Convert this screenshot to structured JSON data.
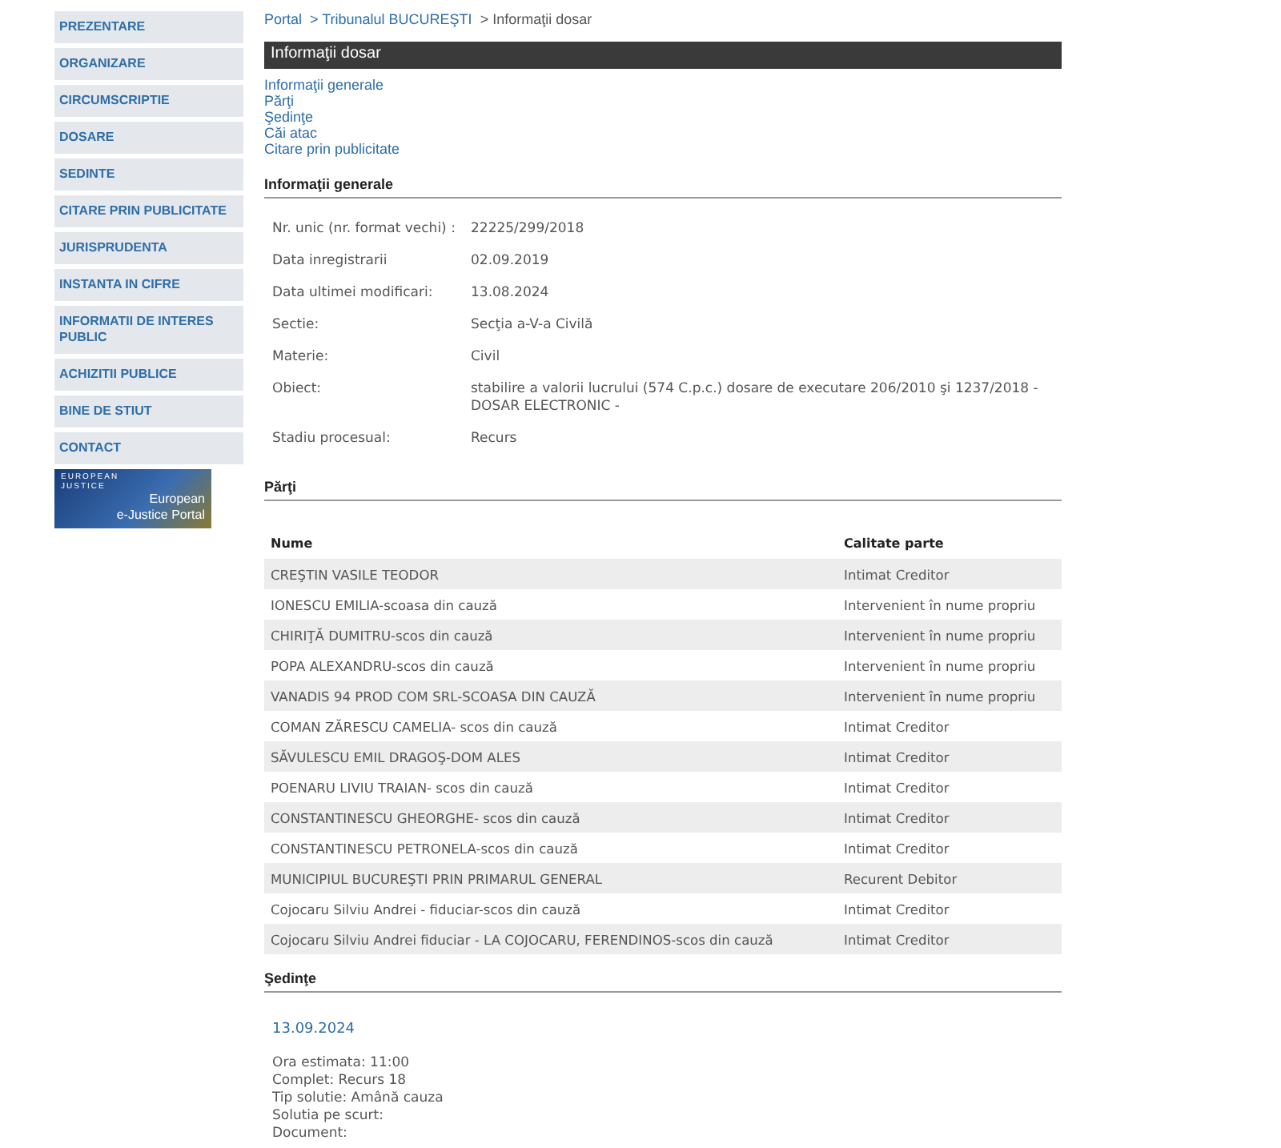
{
  "sidebar": {
    "items": [
      {
        "label": "PREZENTARE"
      },
      {
        "label": "ORGANIZARE"
      },
      {
        "label": "CIRCUMSCRIPTIE"
      },
      {
        "label": "DOSARE"
      },
      {
        "label": "SEDINTE"
      },
      {
        "label": "CITARE PRIN PUBLICITATE"
      },
      {
        "label": "JURISPRUDENTA"
      },
      {
        "label": "INSTANTA IN CIFRE"
      },
      {
        "label": "INFORMATII DE INTERES PUBLIC"
      },
      {
        "label": "ACHIZITII PUBLICE"
      },
      {
        "label": "BINE DE STIUT"
      },
      {
        "label": "CONTACT"
      }
    ],
    "banner": {
      "logo_text": "EUROPEAN JUSTICE",
      "title": "European",
      "subtitle": "e-Justice Portal"
    }
  },
  "breadcrumb": [
    {
      "label": "Portal",
      "kind": "link"
    },
    {
      "label": "> Tribunalul BUCUREŞTI",
      "kind": "link"
    },
    {
      "label": "> Informaţii dosar",
      "kind": "text"
    }
  ],
  "page_title": "Informaţii dosar",
  "anchors": [
    "Informaţii generale",
    "Părţi",
    "Şedinţe",
    "Căi atac",
    "Citare prin publicitate"
  ],
  "general": {
    "title": "Informaţii generale",
    "fields": [
      {
        "label": "Nr. unic (nr. format vechi) :",
        "value": "22225/299/2018"
      },
      {
        "label": "Data inregistrarii",
        "value": "02.09.2019"
      },
      {
        "label": "Data ultimei modificari:",
        "value": "13.08.2024"
      },
      {
        "label": "Sectie:",
        "value": "Secţia a-V-a Civilă"
      },
      {
        "label": "Materie:",
        "value": "Civil"
      },
      {
        "label": "Obiect:",
        "value": "stabilire a valorii lucrului (574 C.p.c.) dosare de executare 206/2010 şi 1237/2018 - DOSAR ELECTRONIC -"
      },
      {
        "label": "Stadiu procesual:",
        "value": "Recurs"
      }
    ]
  },
  "parties": {
    "title": "Părţi",
    "columns": [
      "Nume",
      "Calitate parte"
    ],
    "rows": [
      [
        "CREŞTIN VASILE TEODOR",
        "Intimat Creditor"
      ],
      [
        "IONESCU EMILIA-scoasa din cauză",
        "Intervenient în nume propriu"
      ],
      [
        "CHIRIŢĂ DUMITRU-scos din cauză",
        "Intervenient în nume propriu"
      ],
      [
        "POPA ALEXANDRU-scos din cauză",
        "Intervenient în nume propriu"
      ],
      [
        "VANADIS 94 PROD COM SRL-SCOASA DIN CAUZĂ",
        "Intervenient în nume propriu"
      ],
      [
        "COMAN ZĂRESCU CAMELIA- scos din cauză",
        "Intimat Creditor"
      ],
      [
        "SĂVULESCU EMIL DRAGOŞ-DOM ALES",
        "Intimat Creditor"
      ],
      [
        "POENARU LIVIU TRAIAN- scos din cauză",
        "Intimat Creditor"
      ],
      [
        "CONSTANTINESCU GHEORGHE- scos din cauză",
        "Intimat Creditor"
      ],
      [
        "CONSTANTINESCU PETRONELA-scos din cauză",
        "Intimat Creditor"
      ],
      [
        "MUNICIPIUL BUCUREŞTI PRIN PRIMARUL GENERAL",
        "Recurent Debitor"
      ],
      [
        "Cojocaru Silviu Andrei - fiduciar-scos din cauză",
        "Intimat Creditor"
      ],
      [
        "Cojocaru Silviu Andrei fiduciar - LA COJOCARU, FERENDINOS-scos din cauză",
        "Intimat Creditor"
      ]
    ]
  },
  "hearings": {
    "title": "Şedinţe",
    "items": [
      {
        "date": "13.09.2024",
        "details": [
          "Ora estimata: 11:00",
          "Complet: Recurs 18",
          "Tip solutie: Amână cauza",
          "Solutia pe scurt:",
          "Document:"
        ]
      }
    ]
  }
}
